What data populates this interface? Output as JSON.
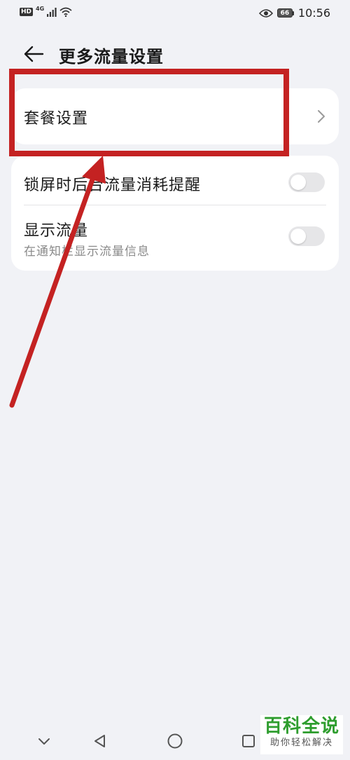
{
  "status_bar": {
    "hd_label": "HD",
    "network_label": "4G",
    "battery_level": "66",
    "time": "10:56",
    "icons": [
      "signal-icon",
      "wifi-icon",
      "eye-icon",
      "battery-icon"
    ]
  },
  "header": {
    "title": "更多流量设置",
    "back_icon": "arrow-left-icon"
  },
  "plan_settings": {
    "label": "套餐设置",
    "chevron_icon": "chevron-right-icon"
  },
  "lockscreen_reminder": {
    "label": "锁屏时后台流量消耗提醒",
    "enabled": false
  },
  "show_data": {
    "label": "显示流量",
    "description": "在通知栏显示流量信息",
    "enabled": false
  },
  "nav_bar": {
    "icons": [
      "chevron-down-icon",
      "back-triangle-icon",
      "home-circle-icon",
      "recents-square-icon"
    ]
  },
  "watermark": {
    "title": "百科全说",
    "subtitle": "助你轻松解决"
  },
  "colors": {
    "background": "#f1f2f6",
    "card": "#ffffff",
    "annotation_red": "#c42222",
    "watermark_green": "#2e9d2e"
  }
}
